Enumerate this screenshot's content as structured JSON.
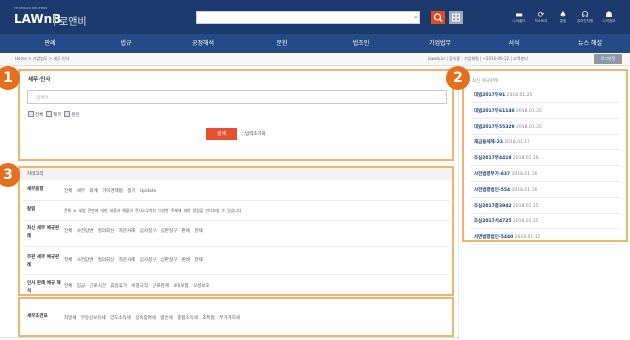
{
  "header": {
    "small_caption": "THOMSON REUTERS",
    "logo": "LAWnB",
    "logo_sub": "로앤비",
    "search_placeholder": "",
    "icons": [
      {
        "name": "folder-icon",
        "glyph": "▬",
        "label": "나의폴더"
      },
      {
        "name": "history-icon",
        "glyph": "⟳",
        "label": "히스토리"
      },
      {
        "name": "alert-icon",
        "glyph": "♠",
        "label": "알림"
      },
      {
        "name": "support-icon",
        "glyph": "☊",
        "label": "온라인지원"
      },
      {
        "name": "user-icon",
        "glyph": "☗",
        "label": "나의정보"
      }
    ]
  },
  "nav": [
    "판례",
    "법규",
    "공정해석",
    "문헌",
    "법조인",
    "기업법무",
    "서식",
    "뉴스 해설"
  ],
  "breadcrumb": "Home > 기업법무 > 세무·인사",
  "crumb_right": "lawnb.kr  |  접속중 : 기업회원  |  ~2016-06-22  |  고객센터",
  "logout": "로그아웃",
  "section1": {
    "badge": "1",
    "title": "세무·인사",
    "input_placeholder": "검색어",
    "options": [
      "전체",
      "제목",
      "본문"
    ],
    "search_button": "검색",
    "reset": "입력초기화"
  },
  "section2": {
    "badge": "2",
    "title": "최신 예규판례",
    "items": [
      {
        "name": "대법2017두91",
        "date": "2018.01.25"
      },
      {
        "name": "대법2017두61140",
        "date": "2018.01.25"
      },
      {
        "name": "대법2017두55329",
        "date": "2018.01.25"
      },
      {
        "name": "재금융세제-23",
        "date": "2018.01.17"
      },
      {
        "name": "조심2017부4419",
        "date": "2018.01.16"
      },
      {
        "name": "사전법령부가-837",
        "date": "2018.01.16"
      },
      {
        "name": "사전법령법인-554",
        "date": "2018.01.16"
      },
      {
        "name": "조심2017중3942",
        "date": "2018.01.15"
      },
      {
        "name": "조심2017서4725",
        "date": "2018.01.15"
      },
      {
        "name": "서면법령법인-5440",
        "date": "2018.01.12"
      }
    ]
  },
  "section3": {
    "badge": "3",
    "title": "카테고리",
    "rows": [
      {
        "label": "세무동향",
        "items": "전체 세무 회계 가이경제법 정기 Update"
      },
      {
        "label": "칼럼",
        "items": "전체 ※ 세법 전반에 대한 내용과 예물의 전사노무까지 다양한 주제에 대한 칼럼을 만나보실 수 있습니다."
      },
      {
        "label": "최신 세무 예규판례",
        "items": "전체 사전답변 질의회신 자문사례 심사청구 심판청구 판례 헌재"
      },
      {
        "label": "주판 세무 예규판례",
        "items": "전체 사전답변 질의회신 자문사례 심사청구 심판청구 판례 헌재"
      },
      {
        "label": "인사 판례 예규 해석",
        "items": "전체 임금 근로시간 휴일휴가 비정규직 근로관계 4대보험 모성보호"
      }
    ],
    "tax_row": {
      "label": "세무조견표",
      "items": "지방세 부동산보유세 양도소득세 상속증여세 법인세 종합소득세 조특법 부가가치세"
    }
  }
}
